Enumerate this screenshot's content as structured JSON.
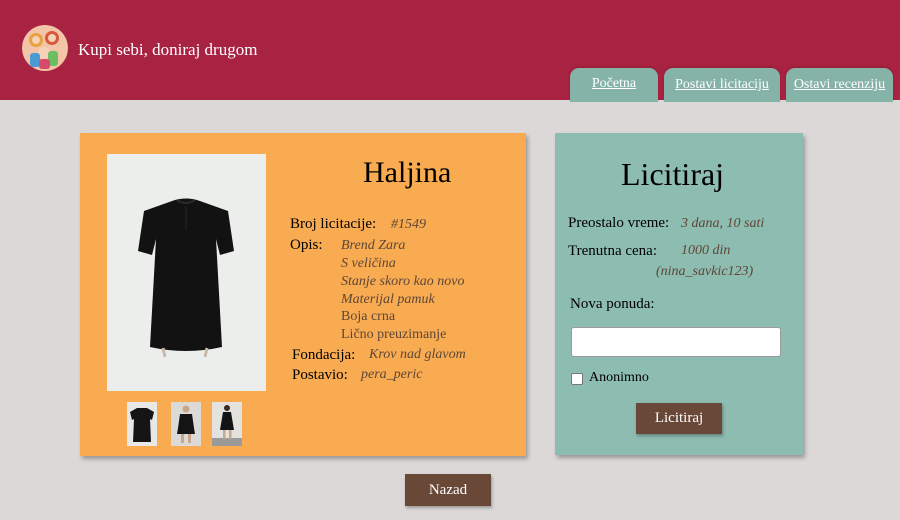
{
  "header": {
    "site_title": "Kupi sebi, doniraj drugom",
    "tabs": [
      {
        "label": "Početna"
      },
      {
        "label": "Postavi licitaciju"
      },
      {
        "label": "Ostavi recenziju"
      }
    ]
  },
  "item": {
    "title": "Haljina",
    "number_label": "Broj licitacije:",
    "number_value": "#1549",
    "description_label": "Opis:",
    "description_lines": [
      "Brend Zara",
      "S veličina",
      "Stanje skoro kao novo",
      "Materijal pamuk",
      "Boja crna",
      "Lično preuzimanje"
    ],
    "foundation_label": "Fondacija:",
    "foundation_value": "Krov nad glavom",
    "posted_label": "Postavio:",
    "posted_value": "pera_peric"
  },
  "bid": {
    "title": "Licitiraj",
    "time_label": "Preostalo vreme:",
    "time_value": "3 dana, 10 sati",
    "price_label": "Trenutna cena:",
    "price_value": "1000 din",
    "price_user": "(nina_savkic123)",
    "new_bid_label": "Nova ponuda:",
    "new_bid_value": "",
    "anonymous_label": "Anonimno",
    "anonymous_checked": false,
    "button_label": "Licitiraj"
  },
  "footer": {
    "back_label": "Nazad"
  },
  "colors": {
    "header": "#a82241",
    "tab": "#86b3a7",
    "item_card": "#f8ab51",
    "bid_card": "#8dbcb0",
    "button": "#6a4838",
    "background": "#dcd8d8"
  }
}
